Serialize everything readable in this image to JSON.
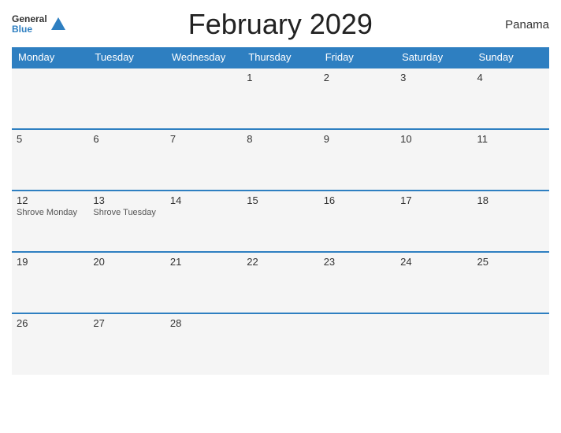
{
  "header": {
    "title": "February 2029",
    "country": "Panama",
    "logo_general": "General",
    "logo_blue": "Blue"
  },
  "columns": [
    "Monday",
    "Tuesday",
    "Wednesday",
    "Thursday",
    "Friday",
    "Saturday",
    "Sunday"
  ],
  "weeks": [
    [
      {
        "day": "",
        "event": ""
      },
      {
        "day": "",
        "event": ""
      },
      {
        "day": "",
        "event": ""
      },
      {
        "day": "1",
        "event": ""
      },
      {
        "day": "2",
        "event": ""
      },
      {
        "day": "3",
        "event": ""
      },
      {
        "day": "4",
        "event": ""
      }
    ],
    [
      {
        "day": "5",
        "event": ""
      },
      {
        "day": "6",
        "event": ""
      },
      {
        "day": "7",
        "event": ""
      },
      {
        "day": "8",
        "event": ""
      },
      {
        "day": "9",
        "event": ""
      },
      {
        "day": "10",
        "event": ""
      },
      {
        "day": "11",
        "event": ""
      }
    ],
    [
      {
        "day": "12",
        "event": "Shrove Monday"
      },
      {
        "day": "13",
        "event": "Shrove Tuesday"
      },
      {
        "day": "14",
        "event": ""
      },
      {
        "day": "15",
        "event": ""
      },
      {
        "day": "16",
        "event": ""
      },
      {
        "day": "17",
        "event": ""
      },
      {
        "day": "18",
        "event": ""
      }
    ],
    [
      {
        "day": "19",
        "event": ""
      },
      {
        "day": "20",
        "event": ""
      },
      {
        "day": "21",
        "event": ""
      },
      {
        "day": "22",
        "event": ""
      },
      {
        "day": "23",
        "event": ""
      },
      {
        "day": "24",
        "event": ""
      },
      {
        "day": "25",
        "event": ""
      }
    ],
    [
      {
        "day": "26",
        "event": ""
      },
      {
        "day": "27",
        "event": ""
      },
      {
        "day": "28",
        "event": ""
      },
      {
        "day": "",
        "event": ""
      },
      {
        "day": "",
        "event": ""
      },
      {
        "day": "",
        "event": ""
      },
      {
        "day": "",
        "event": ""
      }
    ]
  ]
}
